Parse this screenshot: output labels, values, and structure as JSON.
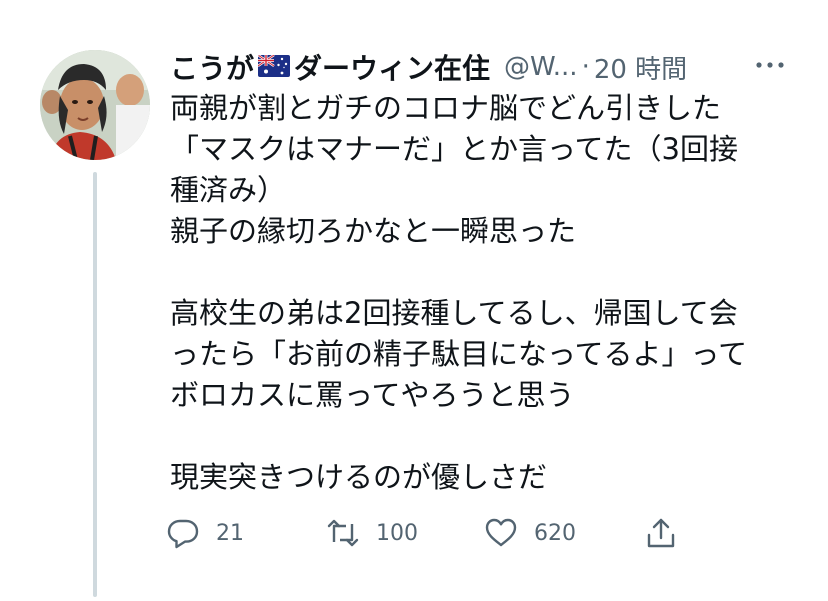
{
  "tweet": {
    "display_name_prefix": "こうが",
    "display_name_suffix": "ダーウィン在住",
    "flag_icon": "australia-flag-icon",
    "handle": "@W...",
    "separator": "·",
    "timestamp": "20 時間",
    "more_icon": "more-options-icon",
    "body_lines": [
      "両親が割とガチのコロナ脳でどん引きした",
      "「マスクはマナーだ」とか言ってた（3回接",
      "種済み）",
      "親子の縁切ろかなと一瞬思った",
      "",
      "高校生の弟は2回接種してるし、帰国して会",
      "ったら「お前の精子駄目になってるよ」って",
      "ボロカスに罵ってやろうと思う",
      "",
      "現実突きつけるのが優しさだ"
    ]
  },
  "actions": {
    "reply": {
      "icon": "reply-icon",
      "count": "21"
    },
    "retweet": {
      "icon": "retweet-icon",
      "count": "100"
    },
    "like": {
      "icon": "like-heart-icon",
      "count": "620"
    },
    "share": {
      "icon": "share-icon"
    }
  },
  "colors": {
    "text_primary": "#0f1419",
    "text_secondary": "#536471",
    "thread_line": "#cfd9de"
  }
}
